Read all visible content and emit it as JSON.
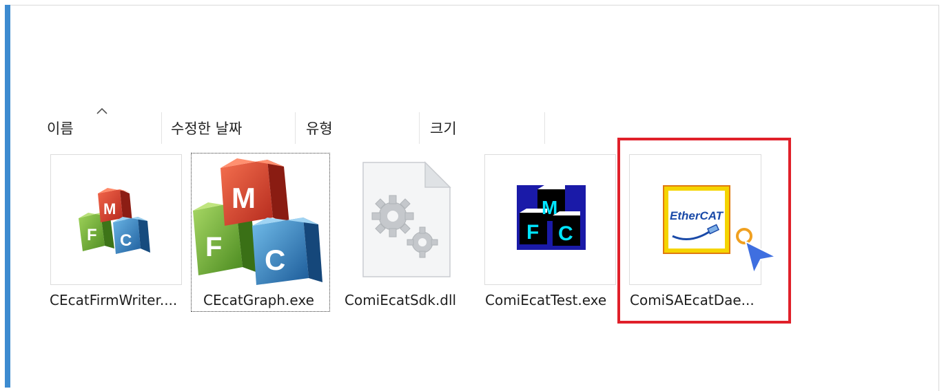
{
  "columns": [
    {
      "label": "이름"
    },
    {
      "label": "수정한 날짜"
    },
    {
      "label": "유형"
    },
    {
      "label": "크기"
    }
  ],
  "files": [
    {
      "name": "CEcatFirmWriter....",
      "icon": "mfc-app-icon"
    },
    {
      "name": "CEcatGraph.exe",
      "icon": "mfc-app-icon-large"
    },
    {
      "name": "ComiEcatSdk.dll",
      "icon": "dll-gear-icon"
    },
    {
      "name": "ComiEcatTest.exe",
      "icon": "mfc-app-icon-lowcolor"
    },
    {
      "name": "ComiSAEcatDae...",
      "icon": "ethercat-icon"
    }
  ],
  "icon_text": {
    "ethercat": "EtherCAT",
    "m": "M",
    "f": "F",
    "c": "C"
  },
  "colors": {
    "accent_bar": "#3d8bd0",
    "highlight_border": "#e0202a",
    "cursor": "#3f6fe0",
    "busy_ring": "#f0a020"
  }
}
